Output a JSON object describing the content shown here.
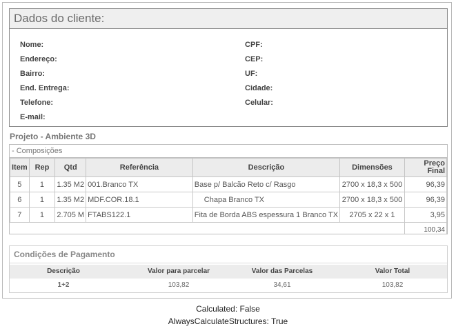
{
  "client": {
    "title": "Dados do cliente:",
    "left_fields": [
      "Nome:",
      "Endereço:",
      "Bairro:",
      "End. Entrega:",
      "Telefone:",
      "E-mail:"
    ],
    "right_fields": [
      "CPF:",
      "CEP:",
      "UF:",
      "Cidade:",
      "Celular:"
    ]
  },
  "project": {
    "title": "Projeto - Ambiente 3D",
    "section_label": "- Composições",
    "columns": [
      "Item",
      "Rep",
      "Qtd",
      "Referência",
      "Descrição",
      "Dimensões",
      "Preço Final"
    ],
    "rows": [
      {
        "item": "5",
        "rep": "1",
        "qtd": "1.35 M2",
        "ref": "001.Branco TX",
        "desc": "Base p/ Balcão Reto c/ Rasgo",
        "dim": "2700 x 18,3 x 500",
        "price": "96,39"
      },
      {
        "item": "6",
        "rep": "1",
        "qtd": "1.35 M2",
        "ref": "MDF.COR.18.1",
        "desc": "Chapa Branco TX",
        "dim": "2700 x 18,3 x 500",
        "price": "96,39"
      },
      {
        "item": "7",
        "rep": "1",
        "qtd": "2.705 M",
        "ref": "FTABS122.1",
        "desc": "Fita de Borda ABS espessura 1 Branco TX",
        "dim": "2705 x 22 x 1",
        "price": "3,95"
      }
    ],
    "total": "100,34"
  },
  "payment": {
    "title": "Condições de Pagamento",
    "columns": [
      "Descrição",
      "Valor para parcelar",
      "Valor das Parcelas",
      "Valor Total"
    ],
    "row": [
      "1+2",
      "103,82",
      "34,61",
      "103,82"
    ]
  },
  "footer": {
    "line1": "Calculated: False",
    "line2": "AlwaysCalculateStructures: True"
  }
}
